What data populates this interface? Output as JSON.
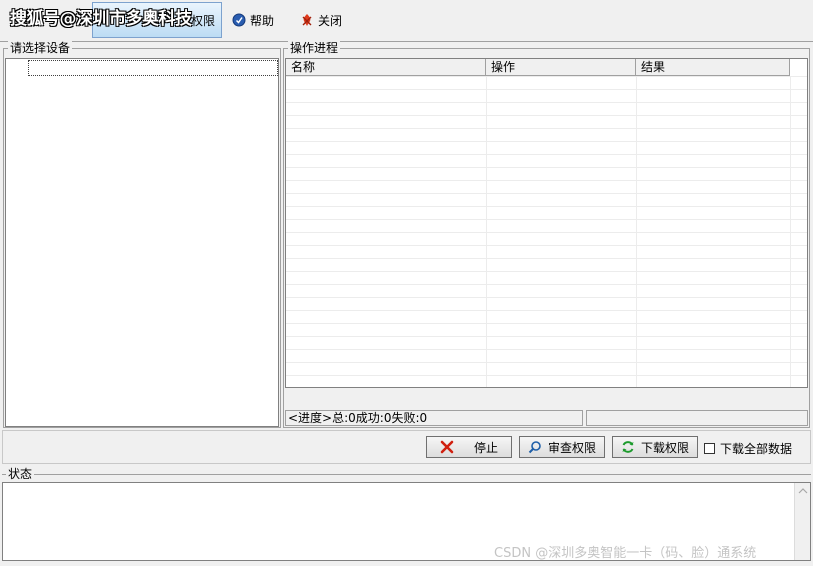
{
  "watermark": "搜狐号@深圳市多奥科技",
  "toolbar": {
    "partial_label": "权限",
    "help_label": "帮助",
    "close_label": "关闭"
  },
  "device_panel": {
    "title": "请选择设备"
  },
  "progress_panel": {
    "title": "操作进程",
    "columns": [
      "名称",
      "操作",
      "结果"
    ],
    "status_text": "<进度>总:0成功:0失败:0"
  },
  "actions": {
    "stop_label": "停止",
    "audit_label": "审查权限",
    "download_label": "下载权限",
    "download_all_label": "下载全部数据",
    "download_all_checked": false
  },
  "status_panel": {
    "title": "状态"
  },
  "csdn_watermark": "CSDN @深圳多奥智能一卡（码、脸）通系统"
}
